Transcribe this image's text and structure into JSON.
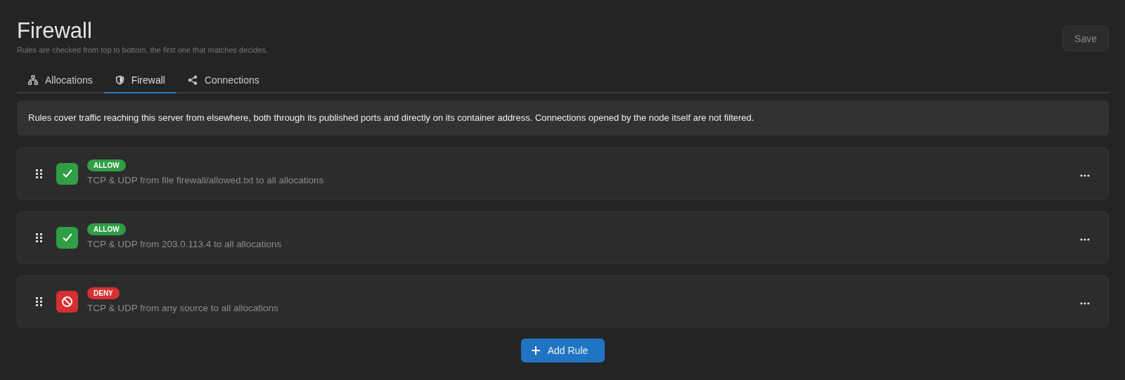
{
  "header": {
    "title": "Firewall",
    "subtitle": "Rules are checked from top to bottom, the first one that matches decides.",
    "save_button": {
      "label": "Save",
      "disabled": true
    }
  },
  "tabs": [
    {
      "label": "Allocations",
      "selected": false
    },
    {
      "label": "Firewall",
      "selected": true
    },
    {
      "label": "Connections",
      "selected": false
    }
  ],
  "notice": "Rules cover traffic reaching this server from elsewhere, both through its published ports and directly on its container address. Connections opened by the node itself are not filtered.",
  "rules": [
    {
      "kind": "allow",
      "badge": "ALLOW",
      "description": "TCP & UDP from file firewall/allowed.txt to all allocations"
    },
    {
      "kind": "allow",
      "badge": "ALLOW",
      "description": "TCP & UDP from 203.0.113.4 to all allocations"
    },
    {
      "kind": "deny",
      "badge": "DENY",
      "description": "TCP & UDP from any source to all allocations"
    }
  ],
  "add_button": {
    "label": "Add Rule"
  }
}
